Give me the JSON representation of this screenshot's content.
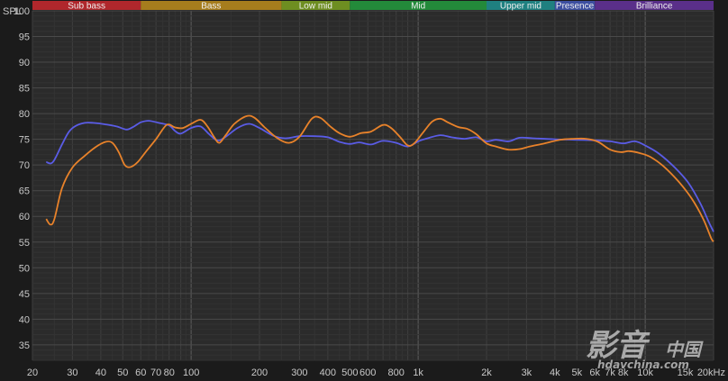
{
  "chart_data": {
    "type": "line",
    "title": "",
    "xlabel": "",
    "ylabel": "SPL",
    "x_scale": "log",
    "xlim": [
      20,
      20000
    ],
    "ylim": [
      32,
      100
    ],
    "grid": true,
    "y_ticks": [
      35,
      40,
      45,
      50,
      55,
      60,
      65,
      70,
      75,
      80,
      85,
      90,
      95,
      100
    ],
    "x_ticks": [
      {
        "v": 20,
        "label": "20"
      },
      {
        "v": 30,
        "label": "30"
      },
      {
        "v": 40,
        "label": "40"
      },
      {
        "v": 50,
        "label": "50"
      },
      {
        "v": 60,
        "label": "60"
      },
      {
        "v": 70,
        "label": "70"
      },
      {
        "v": 80,
        "label": "80"
      },
      {
        "v": 100,
        "label": "100"
      },
      {
        "v": 200,
        "label": "200"
      },
      {
        "v": 300,
        "label": "300"
      },
      {
        "v": 400,
        "label": "400"
      },
      {
        "v": 500,
        "label": "500"
      },
      {
        "v": 600,
        "label": "600"
      },
      {
        "v": 800,
        "label": "800"
      },
      {
        "v": 1000,
        "label": "1k"
      },
      {
        "v": 2000,
        "label": "2k"
      },
      {
        "v": 3000,
        "label": "3k"
      },
      {
        "v": 4000,
        "label": "4k"
      },
      {
        "v": 5000,
        "label": "5k"
      },
      {
        "v": 6000,
        "label": "6k"
      },
      {
        "v": 7000,
        "label": "7k"
      },
      {
        "v": 8000,
        "label": "8k"
      },
      {
        "v": 10000,
        "label": "10k"
      },
      {
        "v": 15000,
        "label": "15k"
      },
      {
        "v": 20000,
        "label": "20kHz"
      }
    ],
    "bands": [
      {
        "name": "Sub bass",
        "from": 20,
        "to": 60,
        "color": "#b0272c"
      },
      {
        "name": "Bass",
        "from": 60,
        "to": 250,
        "color": "#a67d1d"
      },
      {
        "name": "Low mid",
        "from": 250,
        "to": 500,
        "color": "#6e8e21"
      },
      {
        "name": "Mid",
        "from": 500,
        "to": 2000,
        "color": "#238a3a"
      },
      {
        "name": "Upper mid",
        "from": 2000,
        "to": 4000,
        "color": "#1f8080"
      },
      {
        "name": "Presence",
        "from": 4000,
        "to": 6000,
        "color": "#3d4fa0"
      },
      {
        "name": "Brilliance",
        "from": 6000,
        "to": 20000,
        "color": "#5a2f8a"
      }
    ],
    "series": [
      {
        "color": "#5a5ce6",
        "points": [
          [
            23,
            70.6
          ],
          [
            24,
            70.3
          ],
          [
            25,
            71
          ],
          [
            27,
            74
          ],
          [
            29,
            76.5
          ],
          [
            31,
            77.6
          ],
          [
            34,
            78.2
          ],
          [
            37,
            78.2
          ],
          [
            42,
            77.9
          ],
          [
            47,
            77.5
          ],
          [
            52,
            76.9
          ],
          [
            56,
            77.5
          ],
          [
            60,
            78.3
          ],
          [
            65,
            78.6
          ],
          [
            72,
            78.2
          ],
          [
            80,
            77.7
          ],
          [
            85,
            76.6
          ],
          [
            90,
            76.1
          ],
          [
            100,
            77.2
          ],
          [
            110,
            77.5
          ],
          [
            120,
            76
          ],
          [
            130,
            74.8
          ],
          [
            140,
            75.3
          ],
          [
            160,
            77.2
          ],
          [
            180,
            78
          ],
          [
            200,
            77.2
          ],
          [
            230,
            75.7
          ],
          [
            260,
            75.2
          ],
          [
            300,
            75.6
          ],
          [
            350,
            75.6
          ],
          [
            400,
            75.4
          ],
          [
            450,
            74.5
          ],
          [
            500,
            74.1
          ],
          [
            550,
            74.4
          ],
          [
            620,
            74
          ],
          [
            700,
            74.7
          ],
          [
            800,
            74.3
          ],
          [
            900,
            73.6
          ],
          [
            1000,
            74.6
          ],
          [
            1100,
            75.2
          ],
          [
            1250,
            75.8
          ],
          [
            1400,
            75.4
          ],
          [
            1600,
            75.1
          ],
          [
            1800,
            75.4
          ],
          [
            2000,
            74.6
          ],
          [
            2200,
            74.9
          ],
          [
            2500,
            74.6
          ],
          [
            2800,
            75.3
          ],
          [
            3200,
            75.2
          ],
          [
            4000,
            75
          ],
          [
            5000,
            74.9
          ],
          [
            6000,
            74.8
          ],
          [
            7000,
            74.6
          ],
          [
            8000,
            74.2
          ],
          [
            9000,
            74.6
          ],
          [
            10000,
            73.8
          ],
          [
            11500,
            72.2
          ],
          [
            13500,
            69.5
          ],
          [
            15500,
            66.5
          ],
          [
            17500,
            62.5
          ],
          [
            19000,
            59
          ],
          [
            20000,
            57
          ]
        ]
      },
      {
        "color": "#e8822a",
        "points": [
          [
            23,
            59.5
          ],
          [
            24,
            58.4
          ],
          [
            25,
            59.5
          ],
          [
            27,
            65.5
          ],
          [
            30,
            69.5
          ],
          [
            34,
            71.8
          ],
          [
            38,
            73.5
          ],
          [
            42,
            74.5
          ],
          [
            45,
            74.3
          ],
          [
            48,
            72.5
          ],
          [
            51,
            70
          ],
          [
            54,
            69.6
          ],
          [
            58,
            70.5
          ],
          [
            63,
            72.5
          ],
          [
            70,
            75
          ],
          [
            78,
            77.8
          ],
          [
            85,
            77.3
          ],
          [
            92,
            77.2
          ],
          [
            100,
            78
          ],
          [
            110,
            78.8
          ],
          [
            118,
            77.5
          ],
          [
            126,
            75.5
          ],
          [
            133,
            74.3
          ],
          [
            142,
            75.8
          ],
          [
            155,
            78
          ],
          [
            175,
            79.5
          ],
          [
            190,
            79.2
          ],
          [
            210,
            77.4
          ],
          [
            240,
            75.2
          ],
          [
            270,
            74.3
          ],
          [
            300,
            75.5
          ],
          [
            340,
            79
          ],
          [
            370,
            79.2
          ],
          [
            410,
            77.5
          ],
          [
            450,
            76.2
          ],
          [
            500,
            75.5
          ],
          [
            560,
            76.2
          ],
          [
            620,
            76.5
          ],
          [
            700,
            77.8
          ],
          [
            760,
            77.2
          ],
          [
            830,
            75.5
          ],
          [
            900,
            73.8
          ],
          [
            960,
            74.2
          ],
          [
            1050,
            76.3
          ],
          [
            1150,
            78.4
          ],
          [
            1250,
            79
          ],
          [
            1350,
            78.3
          ],
          [
            1500,
            77.4
          ],
          [
            1650,
            77
          ],
          [
            1800,
            76
          ],
          [
            2000,
            74.2
          ],
          [
            2200,
            73.6
          ],
          [
            2500,
            73
          ],
          [
            2800,
            73.1
          ],
          [
            3100,
            73.6
          ],
          [
            3600,
            74.2
          ],
          [
            4200,
            74.9
          ],
          [
            4800,
            75.1
          ],
          [
            5500,
            75.1
          ],
          [
            6200,
            74.5
          ],
          [
            7000,
            73
          ],
          [
            7800,
            72.5
          ],
          [
            8500,
            72.7
          ],
          [
            9500,
            72.3
          ],
          [
            10500,
            71.6
          ],
          [
            12000,
            69.8
          ],
          [
            14000,
            66.8
          ],
          [
            16000,
            63.5
          ],
          [
            18000,
            59.5
          ],
          [
            19500,
            55.8
          ],
          [
            20000,
            55.1
          ]
        ]
      }
    ]
  },
  "watermark": {
    "glyphs": "影音",
    "chinese": "中国",
    "url": "hdavchina.com"
  }
}
